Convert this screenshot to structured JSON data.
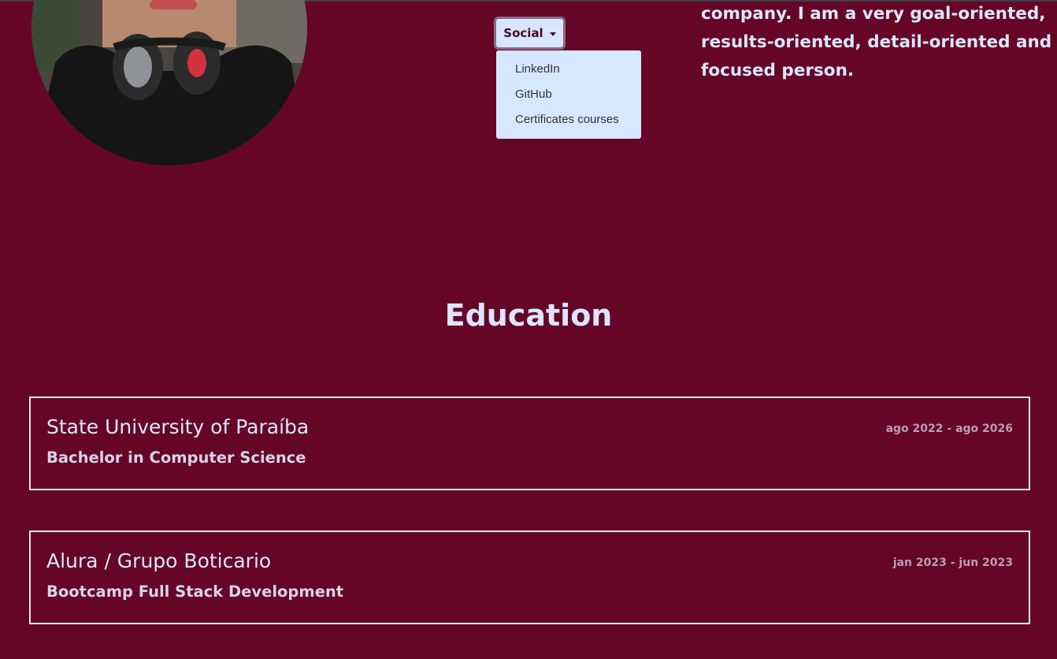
{
  "colors": {
    "background": "#660627",
    "text": "#dbe7ff",
    "dropdown_bg": "#d6e8ff",
    "card_border": "#e4e8f4"
  },
  "profile": {
    "avatar_icon": "profile-photo"
  },
  "social": {
    "button_label": "Social",
    "menu_items": [
      "LinkedIn",
      "GitHub",
      "Certificates courses"
    ]
  },
  "about": {
    "lines": [
      "company. I am a very goal-oriented,",
      "results-oriented, detail-oriented and",
      "focused person."
    ]
  },
  "education": {
    "title": "Education",
    "entries": [
      {
        "school": "State University of Paraíba",
        "degree": "Bachelor in Computer Science",
        "period": "ago 2022 - ago 2026"
      },
      {
        "school": "Alura / Grupo Boticario",
        "degree": "Bootcamp Full Stack Development",
        "period": "jan 2023 - jun 2023"
      }
    ]
  }
}
